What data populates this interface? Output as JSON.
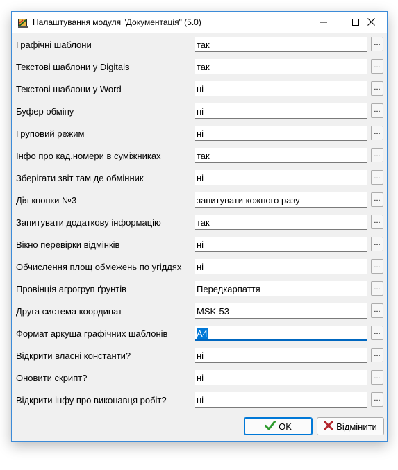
{
  "window": {
    "title": "Налаштування модуля \"Документація\" (5.0)",
    "icons": {
      "app": "book-app-icon",
      "minimize": "minimize-icon",
      "maximize": "maximize-icon",
      "close": "close-icon"
    }
  },
  "rows": [
    {
      "label": "Графічні шаблони",
      "value": "так"
    },
    {
      "label": "Текстові шаблони у Digitals",
      "value": "так"
    },
    {
      "label": "Текстові шаблони у Word",
      "value": "ні"
    },
    {
      "label": "Буфер обміну",
      "value": "ні"
    },
    {
      "label": "Груповий режим",
      "value": "ні"
    },
    {
      "label": "Інфо про кад.номери в суміжниках",
      "value": "так"
    },
    {
      "label": "Зберігати звіт там де обмінник",
      "value": "ні"
    },
    {
      "label": "Дія кнопки №3",
      "value": "запитувати кожного разу"
    },
    {
      "label": "Запитувати додаткову інформацію",
      "value": "так"
    },
    {
      "label": "Вікно перевірки відмінків",
      "value": "ні"
    },
    {
      "label": "Обчислення площ обмежень по угіддях",
      "value": "ні"
    },
    {
      "label": "Провінція агрогруп ґрунтів",
      "value": "Передкарпаття"
    },
    {
      "label": "Друга система координат",
      "value": "MSK-53"
    },
    {
      "label": "Формат аркуша графічних шаблонів",
      "value": "A4"
    },
    {
      "label": "Відкрити власні константи?",
      "value": "ні"
    },
    {
      "label": "Оновити скрипт?",
      "value": "ні"
    },
    {
      "label": "Відкрити інфу про виконавця робіт?",
      "value": "ні"
    }
  ],
  "browse_button_label": "...",
  "focused_row": 13,
  "buttons": {
    "ok": {
      "label": "OK",
      "icon": "checkmark-icon"
    },
    "cancel": {
      "label": "Відмінити",
      "icon": "x-cancel-icon"
    }
  },
  "colors": {
    "accent": "#0078d7",
    "ok_check": "#2c9a2c",
    "cancel_x": "#b3262d"
  }
}
